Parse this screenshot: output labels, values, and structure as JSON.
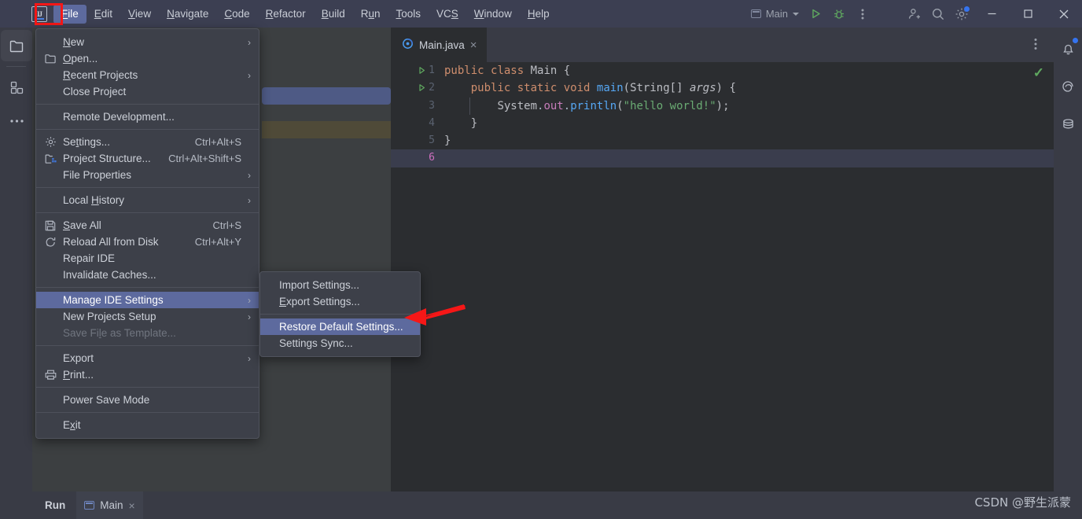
{
  "window": {
    "app_logo": "intellij-logo",
    "menus": [
      {
        "label": "File",
        "mnemonic": "F",
        "active": true
      },
      {
        "label": "Edit",
        "mnemonic": "E",
        "active": false
      },
      {
        "label": "View",
        "mnemonic": "V",
        "active": false
      },
      {
        "label": "Navigate",
        "mnemonic": "N",
        "active": false
      },
      {
        "label": "Code",
        "mnemonic": "C",
        "active": false
      },
      {
        "label": "Refactor",
        "mnemonic": "R",
        "active": false
      },
      {
        "label": "Build",
        "mnemonic": "B",
        "active": false
      },
      {
        "label": "Run",
        "mnemonic": "u",
        "active": false
      },
      {
        "label": "Tools",
        "mnemonic": "T",
        "active": false
      },
      {
        "label": "VCS",
        "mnemonic": "S",
        "active": false
      },
      {
        "label": "Window",
        "mnemonic": "W",
        "active": false
      },
      {
        "label": "Help",
        "mnemonic": "H",
        "active": false
      }
    ],
    "run_config": "Main",
    "toolbar_icons": [
      "run-icon",
      "debug-icon",
      "more-options-icon",
      "add-user-icon",
      "search-icon",
      "settings-gear-icon"
    ],
    "window_controls": [
      "minimize-button",
      "maximize-button",
      "close-button"
    ]
  },
  "left_rail": {
    "items": [
      "project-folder-icon",
      "structure-icon",
      "more-tool-windows-icon"
    ]
  },
  "right_rail": {
    "items": [
      "notifications-bell-icon",
      "ai-assistant-icon",
      "database-icon"
    ]
  },
  "file_menu": {
    "items": [
      {
        "label": "New",
        "mnemonic": "N",
        "submenu": true,
        "icon": "",
        "shortcut": ""
      },
      {
        "label": "Open...",
        "mnemonic": "O",
        "submenu": false,
        "icon": "folder-icon",
        "shortcut": ""
      },
      {
        "label": "Recent Projects",
        "mnemonic": "R",
        "submenu": true,
        "icon": "",
        "shortcut": ""
      },
      {
        "label": "Close Project",
        "mnemonic": "",
        "submenu": false,
        "icon": "",
        "shortcut": ""
      },
      {
        "separator": true
      },
      {
        "label": "Remote Development...",
        "mnemonic": "",
        "submenu": false,
        "icon": "",
        "shortcut": ""
      },
      {
        "separator": true
      },
      {
        "label": "Settings...",
        "mnemonic": "t",
        "submenu": false,
        "icon": "gear-icon",
        "shortcut": "Ctrl+Alt+S"
      },
      {
        "label": "Project Structure...",
        "mnemonic": "",
        "submenu": false,
        "icon": "project-structure-icon",
        "shortcut": "Ctrl+Alt+Shift+S"
      },
      {
        "label": "File Properties",
        "mnemonic": "",
        "submenu": true,
        "icon": "",
        "shortcut": ""
      },
      {
        "separator": true
      },
      {
        "label": "Local History",
        "mnemonic": "H",
        "submenu": true,
        "icon": "",
        "shortcut": ""
      },
      {
        "separator": true
      },
      {
        "label": "Save All",
        "mnemonic": "S",
        "submenu": false,
        "icon": "save-icon",
        "shortcut": "Ctrl+S"
      },
      {
        "label": "Reload All from Disk",
        "mnemonic": "",
        "submenu": false,
        "icon": "reload-icon",
        "shortcut": "Ctrl+Alt+Y"
      },
      {
        "label": "Repair IDE",
        "mnemonic": "",
        "submenu": false,
        "icon": "",
        "shortcut": ""
      },
      {
        "label": "Invalidate Caches...",
        "mnemonic": "",
        "submenu": false,
        "icon": "",
        "shortcut": ""
      },
      {
        "separator": true
      },
      {
        "label": "Manage IDE Settings",
        "mnemonic": "",
        "submenu": true,
        "icon": "",
        "shortcut": "",
        "highlighted": true,
        "annotated": true
      },
      {
        "label": "New Projects Setup",
        "mnemonic": "",
        "submenu": true,
        "icon": "",
        "shortcut": ""
      },
      {
        "label": "Save File as Template...",
        "mnemonic": "l",
        "submenu": false,
        "icon": "",
        "shortcut": "",
        "disabled": true
      },
      {
        "separator": true
      },
      {
        "label": "Export",
        "mnemonic": "",
        "submenu": true,
        "icon": "",
        "shortcut": ""
      },
      {
        "label": "Print...",
        "mnemonic": "P",
        "submenu": false,
        "icon": "print-icon",
        "shortcut": ""
      },
      {
        "separator": true
      },
      {
        "label": "Power Save Mode",
        "mnemonic": "",
        "submenu": false,
        "icon": "",
        "shortcut": ""
      },
      {
        "separator": true
      },
      {
        "label": "Exit",
        "mnemonic": "x",
        "submenu": false,
        "icon": "",
        "shortcut": ""
      }
    ]
  },
  "manage_ide_settings_submenu": {
    "items": [
      {
        "label": "Import Settings...",
        "mnemonic": "",
        "highlighted": false
      },
      {
        "label": "Export Settings...",
        "mnemonic": "E",
        "highlighted": false
      },
      {
        "separator": true
      },
      {
        "label": "Restore Default Settings...",
        "mnemonic": "",
        "highlighted": true,
        "annotated": true
      },
      {
        "label": "Settings Sync...",
        "mnemonic": "",
        "highlighted": false
      }
    ]
  },
  "editor": {
    "tab": {
      "label": "Main.java",
      "icon": "java-class-icon",
      "close": "×"
    },
    "inspection_status": "✓",
    "lines": [
      {
        "num": "1",
        "runmark": true,
        "tokens": [
          {
            "t": "public",
            "c": "kw"
          },
          {
            "t": " ",
            "c": "pn"
          },
          {
            "t": "class",
            "c": "kw"
          },
          {
            "t": " ",
            "c": "pn"
          },
          {
            "t": "Main",
            "c": "cls"
          },
          {
            "t": " ",
            "c": "pn"
          },
          {
            "t": "{",
            "c": "brk"
          }
        ]
      },
      {
        "num": "2",
        "runmark": true,
        "tokens": [
          {
            "t": "    ",
            "c": "pn"
          },
          {
            "t": "public",
            "c": "kw"
          },
          {
            "t": " ",
            "c": "pn"
          },
          {
            "t": "static",
            "c": "kw"
          },
          {
            "t": " ",
            "c": "pn"
          },
          {
            "t": "void",
            "c": "kw"
          },
          {
            "t": " ",
            "c": "pn"
          },
          {
            "t": "main",
            "c": "fn"
          },
          {
            "t": "(",
            "c": "brk"
          },
          {
            "t": "String",
            "c": "cls"
          },
          {
            "t": "[] ",
            "c": "brk"
          },
          {
            "t": "args",
            "c": "ital"
          },
          {
            "t": ") ",
            "c": "brk"
          },
          {
            "t": "{",
            "c": "brk"
          }
        ]
      },
      {
        "num": "3",
        "runmark": false,
        "tokens": [
          {
            "t": "        ",
            "c": "pn"
          },
          {
            "t": "System",
            "c": "cls"
          },
          {
            "t": ".",
            "c": "pn"
          },
          {
            "t": "out",
            "c": "fld"
          },
          {
            "t": ".",
            "c": "pn"
          },
          {
            "t": "println",
            "c": "meth"
          },
          {
            "t": "(",
            "c": "brk"
          },
          {
            "t": "\"hello world!\"",
            "c": "str"
          },
          {
            "t": ");",
            "c": "brk"
          }
        ]
      },
      {
        "num": "4",
        "runmark": false,
        "tokens": [
          {
            "t": "    ",
            "c": "pn"
          },
          {
            "t": "}",
            "c": "brk"
          }
        ]
      },
      {
        "num": "5",
        "runmark": false,
        "tokens": [
          {
            "t": "}",
            "c": "brk"
          }
        ]
      },
      {
        "num": "6",
        "runmark": false,
        "current": true,
        "tokens": []
      }
    ]
  },
  "bottom_bar": {
    "title": "Run",
    "tab": {
      "label": "Main",
      "icon": "run-config-icon",
      "close": "×"
    }
  },
  "watermark": "CSDN @野生派蒙",
  "colors": {
    "accent_selection": "#5d6a9e",
    "annotation_red": "#f61717",
    "titlebar": "#3c3f52",
    "panel": "#393b45",
    "editor_bg": "#2b2d30",
    "menu_bg": "#3d4049",
    "project_selected": "#4e5a85",
    "project_modified": "#4f4a38"
  }
}
